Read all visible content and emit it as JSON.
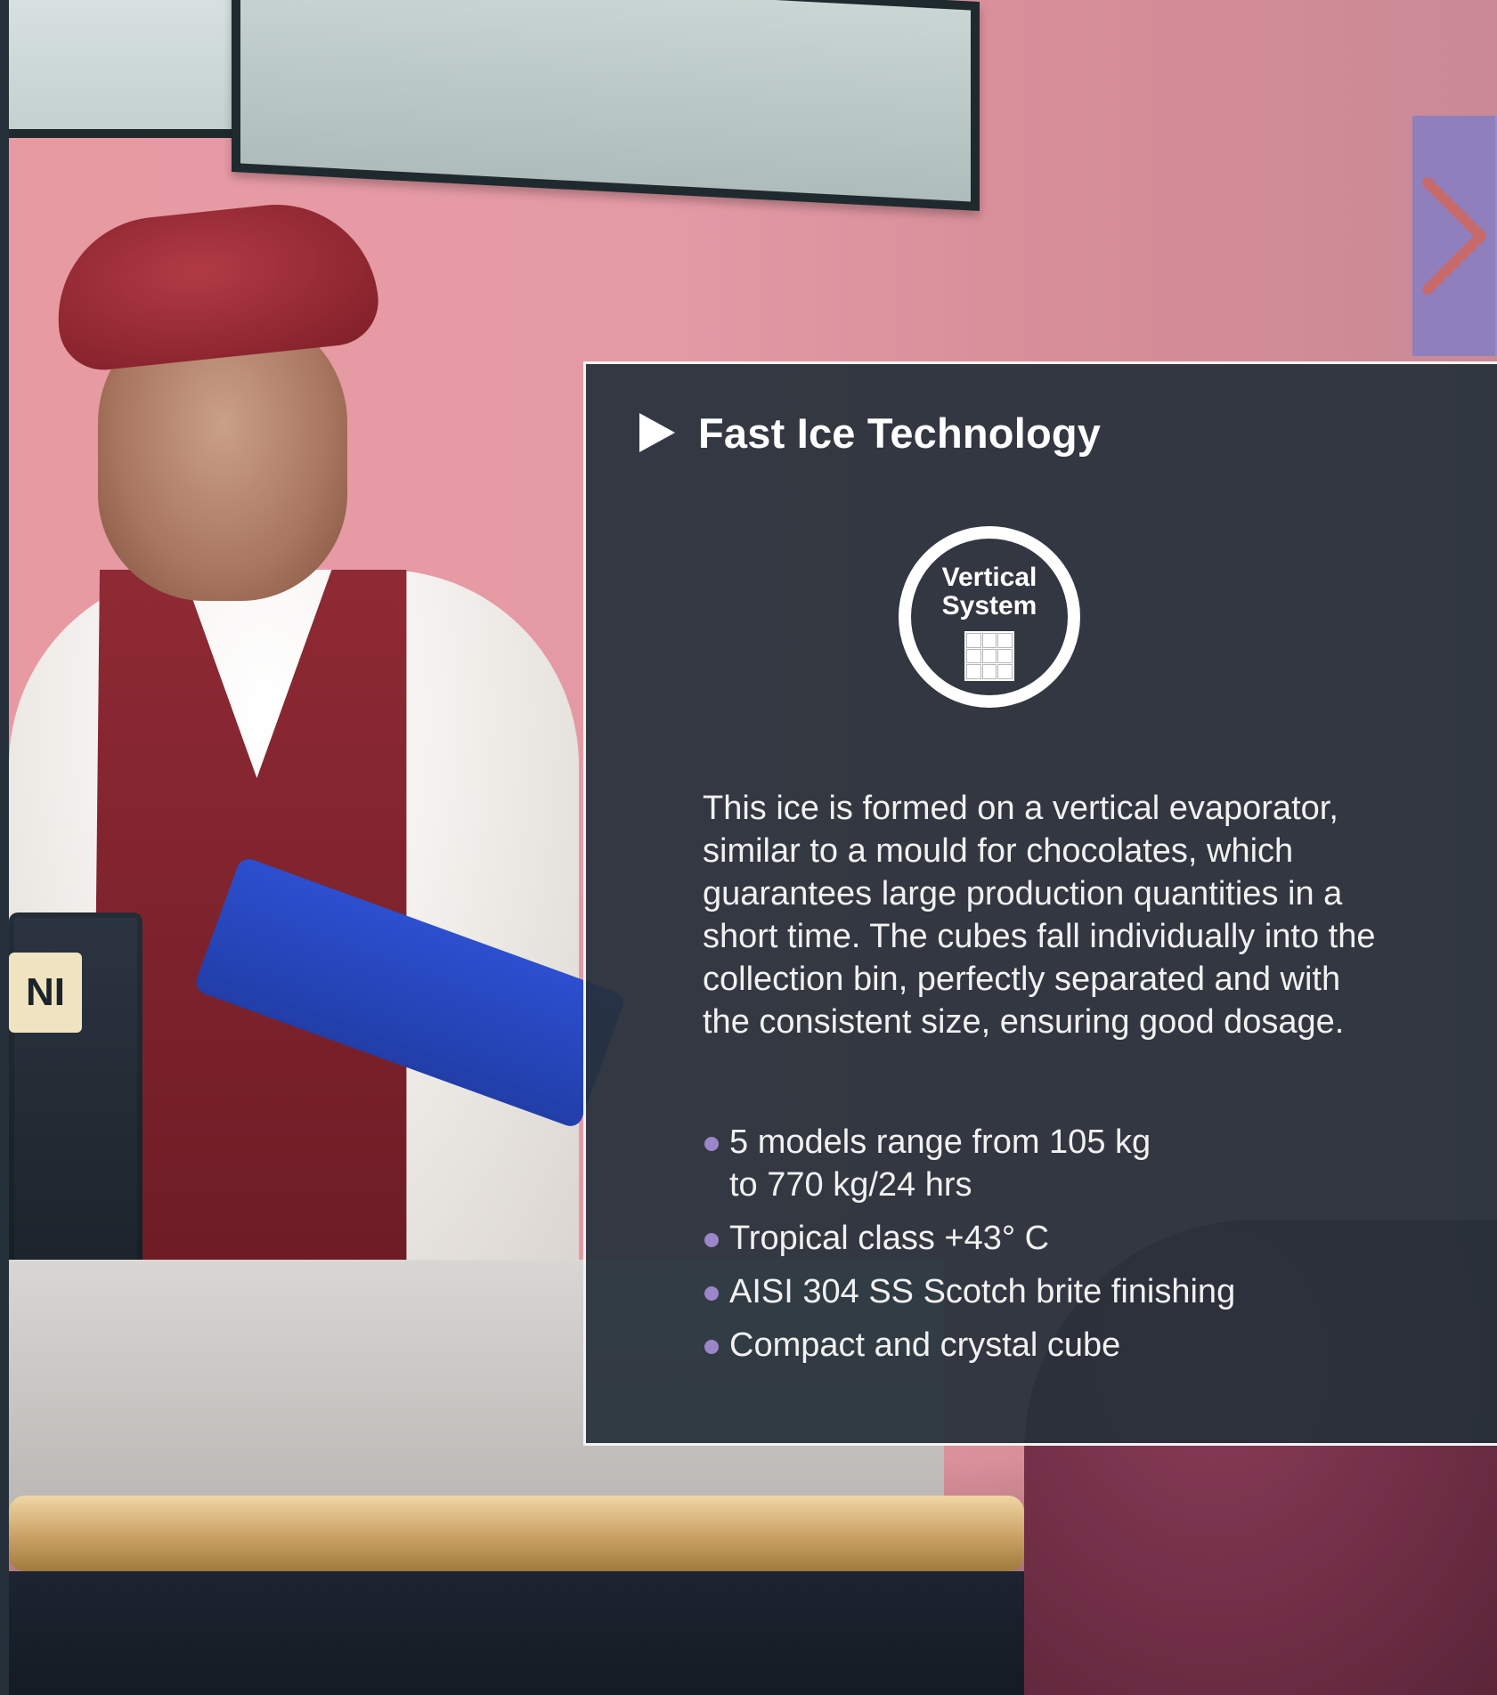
{
  "colors": {
    "panel_bg": "#26303a",
    "panel_border": "#f2f2f2",
    "accent_purple": "#8f7fbd",
    "bullet_dot": "#9a86c8",
    "next_arrow": "#c76a6c"
  },
  "background": {
    "pos_label": "NI"
  },
  "nav": {
    "next_icon": "chevron-right-icon"
  },
  "panel": {
    "title": "Fast Ice Technology",
    "badge": {
      "line1": "Vertical",
      "line2": "System",
      "icon": "grid-icon"
    },
    "description": "This ice is formed on a vertical evaporator,\nsimilar to a mould for chocolates, which\nguarantees large production quantities in a\nshort time. The cubes fall individually into the\ncollection bin, perfectly separated and with\nthe consistent size, ensuring good dosage.",
    "bullets": [
      "5 models range from 105 kg\nto 770 kg/24 hrs",
      "Tropical class +43° C",
      "AISI 304 SS Scotch brite finishing",
      "Compact and crystal cube"
    ]
  }
}
